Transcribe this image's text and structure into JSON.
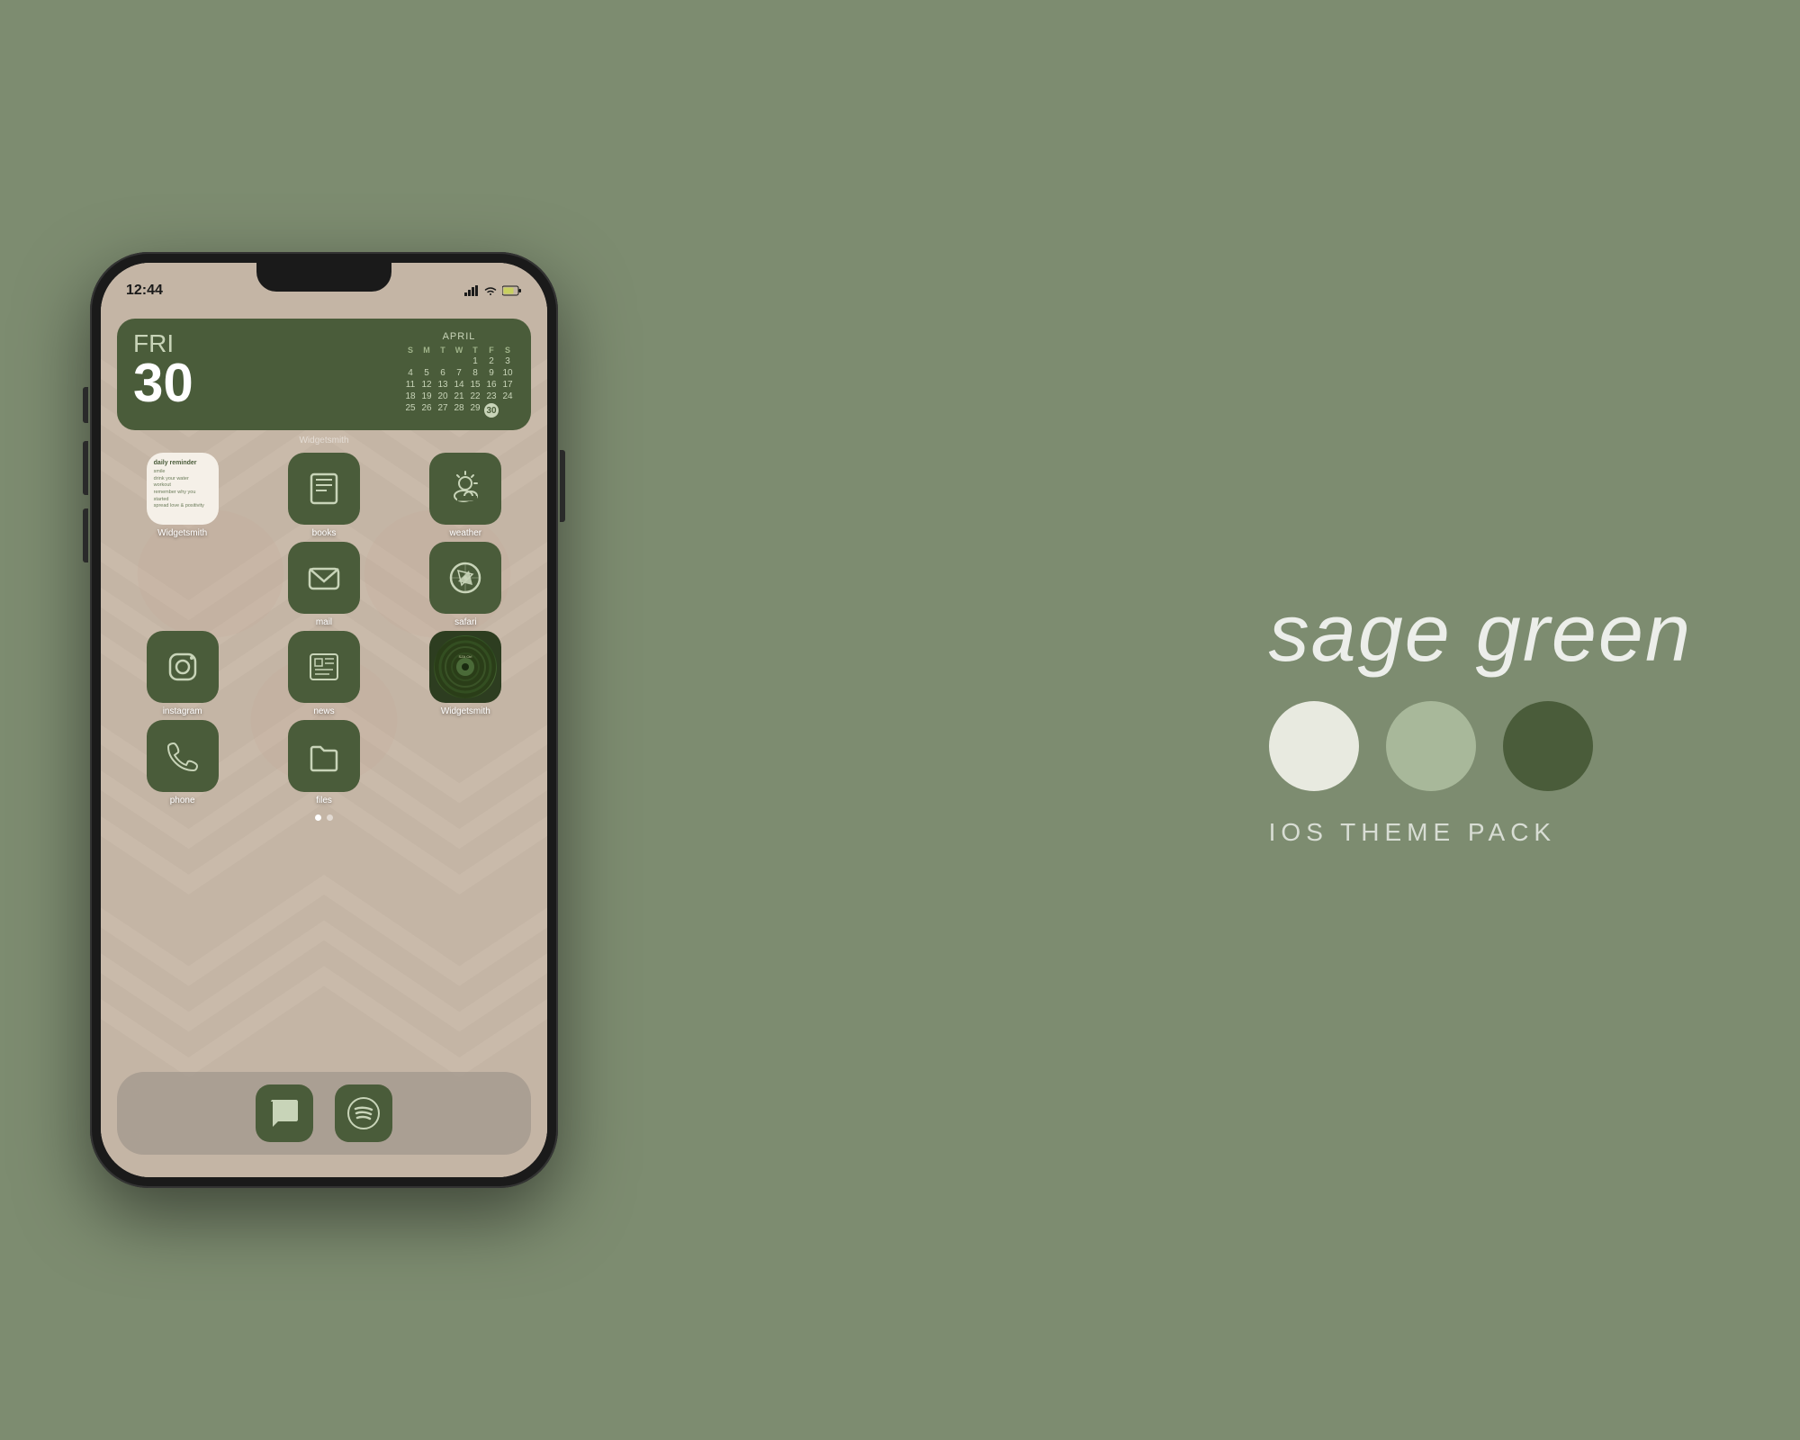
{
  "background_color": "#7d8c70",
  "phone": {
    "status_bar": {
      "time": "12:44",
      "signal_icon": "signal",
      "wifi_icon": "wifi",
      "battery_icon": "battery"
    },
    "widgetsmith_label": "Widgetsmith",
    "calendar": {
      "day_name": "FRI",
      "date": "30",
      "month": "APRIL",
      "day_headers": [
        "S",
        "M",
        "T",
        "W",
        "T",
        "F",
        "S"
      ],
      "weeks": [
        [
          "",
          "",
          "",
          "1",
          "2",
          "3"
        ],
        [
          "4",
          "5",
          "6",
          "7",
          "8",
          "9",
          "10"
        ],
        [
          "11",
          "12",
          "13",
          "14",
          "15",
          "16",
          "17"
        ],
        [
          "18",
          "19",
          "20",
          "21",
          "22",
          "23",
          "24"
        ],
        [
          "25",
          "26",
          "27",
          "28",
          "29",
          "30",
          ""
        ]
      ],
      "today": "30"
    },
    "apps": {
      "row1": [
        {
          "label": "Widgetsmith",
          "type": "widget"
        },
        {
          "label": "books",
          "type": "icon",
          "icon": "book"
        },
        {
          "label": "weather",
          "type": "icon",
          "icon": "cloud-sun"
        }
      ],
      "row2": [
        {
          "label": "",
          "type": "spacer"
        },
        {
          "label": "mail",
          "type": "icon",
          "icon": "envelope"
        },
        {
          "label": "safari",
          "type": "icon",
          "icon": "compass"
        }
      ],
      "row3": [
        {
          "label": "instagram",
          "type": "icon",
          "icon": "instagram"
        },
        {
          "label": "news",
          "type": "icon",
          "icon": "newspaper"
        },
        {
          "label": "Widgetsmith",
          "type": "music"
        }
      ],
      "row4": [
        {
          "label": "phone",
          "type": "icon",
          "icon": "phone"
        },
        {
          "label": "files",
          "type": "icon",
          "icon": "folder"
        },
        {
          "label": "",
          "type": "spacer"
        }
      ]
    },
    "daily_reminder": {
      "title": "daily reminder",
      "lines": [
        "smile",
        "drink your water",
        "workout",
        "remember why you started",
        "spread love & positivity"
      ]
    },
    "page_dots": [
      true,
      false
    ],
    "dock": {
      "apps": [
        "messages",
        "spotify"
      ]
    },
    "music_widget": {
      "artist": "SZA",
      "song": "Ctrl"
    }
  },
  "branding": {
    "theme_name": "sage green",
    "swatches": [
      {
        "name": "light",
        "color": "#e8eae0"
      },
      {
        "name": "mid",
        "color": "#a8b89a"
      },
      {
        "name": "dark",
        "color": "#4a5c3a"
      }
    ],
    "pack_label": "IOS THEME PACK"
  }
}
